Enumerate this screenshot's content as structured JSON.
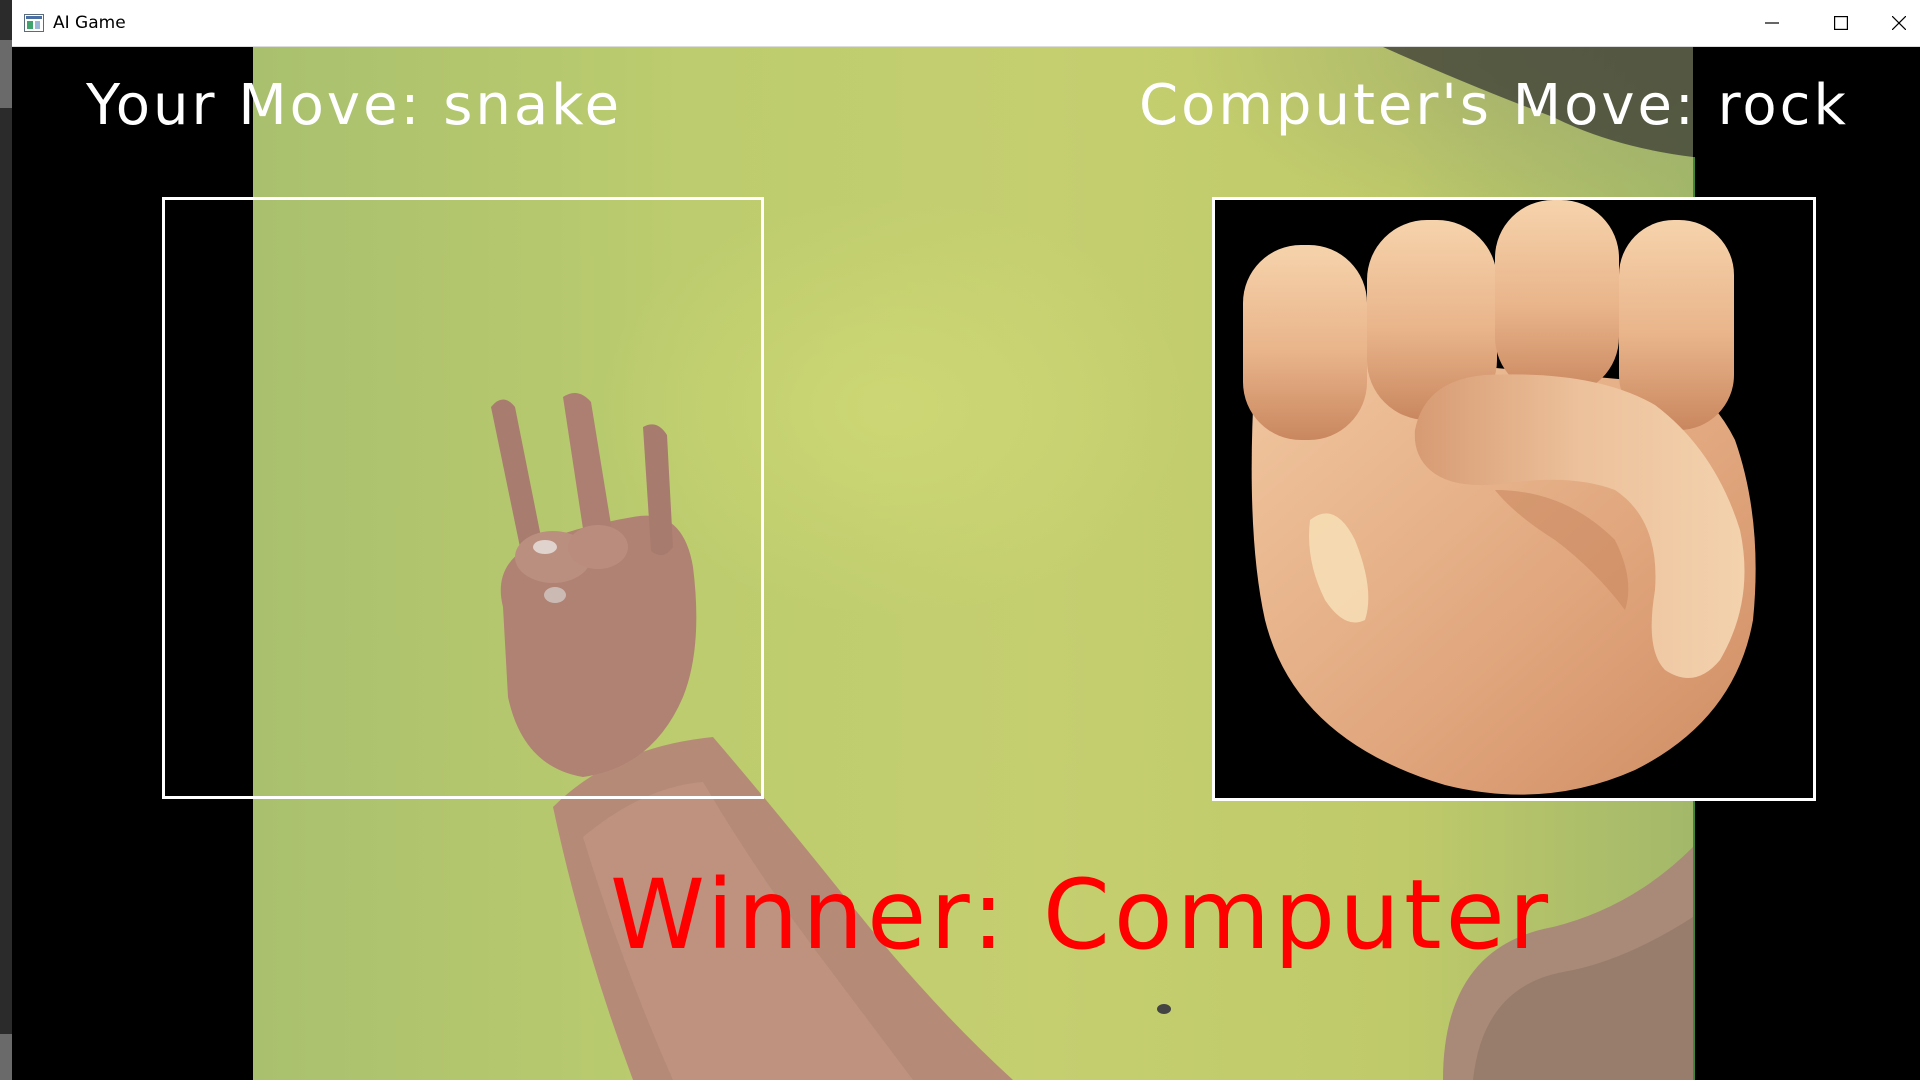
{
  "window": {
    "title": "AI Game",
    "app_icon": "app-window-icon",
    "controls": [
      "minimize-icon",
      "maximize-icon",
      "close-icon"
    ]
  },
  "game": {
    "your_move_label": "Your Move: snake",
    "computer_move_label": "Computer's Move: rock",
    "winner_label": "Winner: Computer",
    "computer_move_image": "rock-fist-emoji",
    "colors": {
      "move_text": "#ffffff",
      "winner_text": "#ff0000",
      "box_border": "#ffffff",
      "background": "#000000"
    }
  }
}
